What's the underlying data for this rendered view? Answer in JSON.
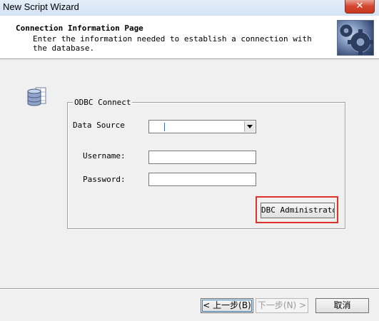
{
  "window": {
    "title": "New Script Wizard",
    "close_label": "✕"
  },
  "header": {
    "title": "Connection Information Page",
    "subtitle": "Enter the information needed to establish a connection with the database.",
    "logo_icon": "gears-icon"
  },
  "form": {
    "db_icon": "database-icon",
    "group_label": "ODBC Connect",
    "data_source_label": "Data Source",
    "data_source_value": "",
    "username_label": "Username:",
    "username_value": "",
    "password_label": "Password:",
    "password_value": "",
    "odbc_admin_label": "DBC Administrator"
  },
  "footer": {
    "back_label": "< 上一步(B)",
    "next_label": "下一步(N) >",
    "cancel_label": "取消"
  },
  "colors": {
    "highlight": "#e0312b",
    "window_bg": "#f0f0f0"
  }
}
